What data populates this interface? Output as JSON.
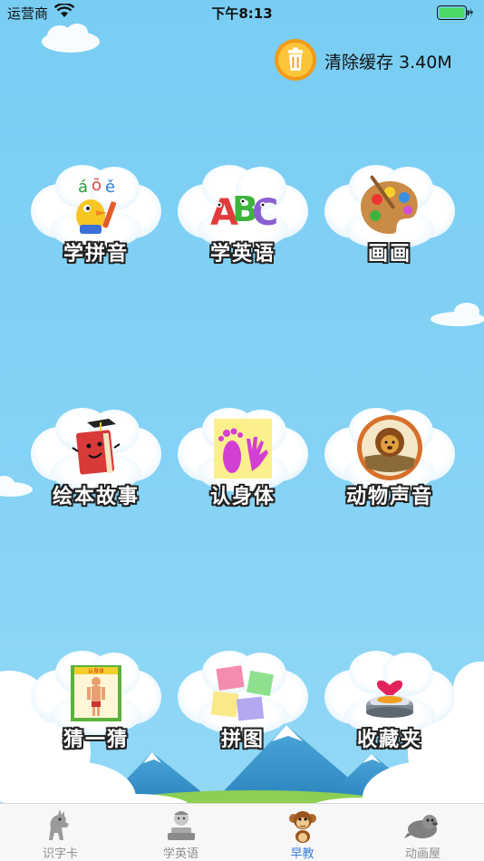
{
  "status_bar": {
    "carrier": "运营商",
    "time": "下午8:13"
  },
  "header": {
    "clear_cache_label": "清除缓存 3.40M"
  },
  "menu": {
    "items": [
      {
        "label": "学拼音",
        "icon": "pinyin-bird-icon"
      },
      {
        "label": "学英语",
        "icon": "abc-letters-icon"
      },
      {
        "label": "画画",
        "icon": "paint-palette-icon"
      },
      {
        "label": "绘本故事",
        "icon": "storybook-icon"
      },
      {
        "label": "认身体",
        "icon": "hand-foot-icon"
      },
      {
        "label": "动物声音",
        "icon": "lion-icon"
      },
      {
        "label": "猜一猜",
        "icon": "body-chart-icon"
      },
      {
        "label": "拼图",
        "icon": "puzzle-icon"
      },
      {
        "label": "收藏夹",
        "icon": "heart-box-icon"
      }
    ]
  },
  "tab_bar": {
    "tabs": [
      {
        "label": "识字卡",
        "icon": "dinosaur-icon",
        "active": false
      },
      {
        "label": "学英语",
        "icon": "reading-child-icon",
        "active": false
      },
      {
        "label": "早教",
        "icon": "monkey-icon",
        "active": true
      },
      {
        "label": "动画屋",
        "icon": "seal-icon",
        "active": false
      }
    ]
  },
  "colors": {
    "sky": "#79cdf3",
    "label_text": "#ffffff",
    "label_outline": "#222222",
    "tab_active": "#3b7fe0",
    "tab_inactive": "#8e8e8e"
  }
}
